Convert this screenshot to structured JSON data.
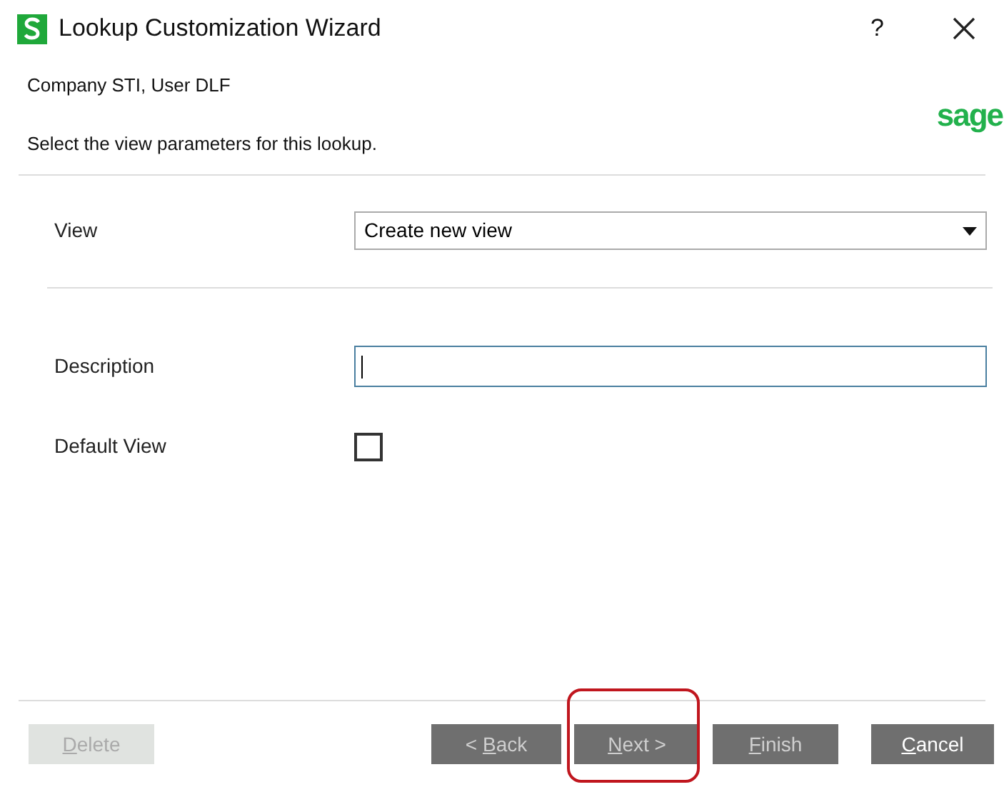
{
  "window": {
    "title": "Lookup Customization Wizard",
    "help": "?"
  },
  "header": {
    "company": "Company STI, User DLF",
    "instruction": "Select the view parameters for this lookup.",
    "logo": "sage"
  },
  "fields": [
    {
      "kind": "dropdown",
      "label": "View",
      "value": "Create new view"
    },
    {
      "kind": "text",
      "label": "Description",
      "focused": true
    },
    {
      "kind": "checkbox",
      "label": "Default View",
      "checked": false
    }
  ],
  "buttons": [
    {
      "key": "D",
      "after": "elete",
      "disabled": true,
      "annotated": false
    },
    {
      "before": "< ",
      "key": "B",
      "after": "ack",
      "disabled": true,
      "annotated": false
    },
    {
      "key": "N",
      "after": "ext >",
      "disabled": true,
      "annotated": true
    },
    {
      "key": "F",
      "after": "inish",
      "disabled": true,
      "annotated": false
    },
    {
      "key": "C",
      "after": "ancel",
      "disabled": false,
      "annotated": false
    }
  ]
}
